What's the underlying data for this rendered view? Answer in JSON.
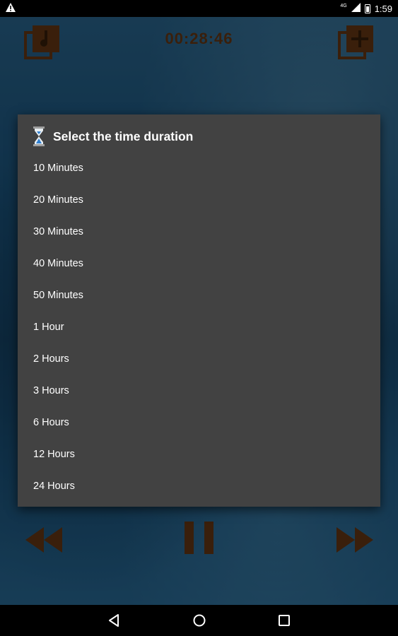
{
  "status_bar": {
    "network": "4G",
    "time": "1:59"
  },
  "player": {
    "timer": "00:28:46"
  },
  "dialog": {
    "title": "Select the time duration",
    "options": [
      "10 Minutes",
      "20 Minutes",
      "30 Minutes",
      "40 Minutes",
      "50 Minutes",
      "1 Hour",
      "2 Hours",
      "3 Hours",
      "6 Hours",
      "12 Hours",
      "24 Hours"
    ]
  },
  "colors": {
    "accent": "#6b3a14",
    "dialog_bg": "#424242",
    "water": "#1d5a86"
  }
}
